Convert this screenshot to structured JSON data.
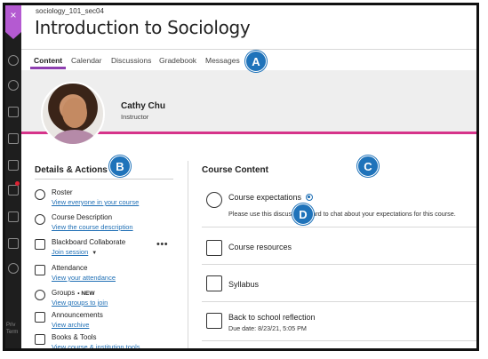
{
  "header": {
    "course_code": "sociology_101_sec04",
    "course_title": "Introduction to Sociology",
    "close_glyph": "×"
  },
  "tabs": [
    {
      "label": "Content",
      "active": true
    },
    {
      "label": "Calendar",
      "active": false
    },
    {
      "label": "Discussions",
      "active": false
    },
    {
      "label": "Gradebook",
      "active": false
    },
    {
      "label": "Messages",
      "active": false
    }
  ],
  "instructor": {
    "name": "Cathy Chu",
    "role": "Instructor"
  },
  "details": {
    "title": "Details & Actions",
    "items": [
      {
        "label": "Roster",
        "link": "View everyone in your course",
        "icon": "roster-icon"
      },
      {
        "label": "Course Description",
        "link": "View the course description",
        "icon": "info-icon"
      },
      {
        "label": "Blackboard Collaborate",
        "link": "Join session",
        "icon": "collaborate-icon"
      },
      {
        "label": "Attendance",
        "link": "View your attendance",
        "icon": "attendance-icon"
      },
      {
        "label": "Groups",
        "badge": "NEW",
        "link": "View groups to join",
        "icon": "groups-icon"
      },
      {
        "label": "Announcements",
        "link": "View archive",
        "icon": "megaphone-icon"
      },
      {
        "label": "Books & Tools",
        "link": "View course & institution tools",
        "icon": "wrench-icon"
      }
    ],
    "more": "•••"
  },
  "content": {
    "title": "Course Content",
    "items": [
      {
        "name": "Course expectations",
        "description": "Please use this discussion board to chat about your expectations for this course.",
        "icon": "discussion-icon"
      },
      {
        "name": "Course resources",
        "icon": "folder-icon"
      },
      {
        "name": "Syllabus",
        "icon": "document-icon"
      },
      {
        "name": "Back to school reflection",
        "due": "Due date: 8/23/21, 5:05 PM",
        "icon": "assignment-icon"
      }
    ]
  },
  "rail": {
    "privacy_text": "Priv\nTerm"
  },
  "callouts": [
    "A",
    "B",
    "C",
    "D"
  ],
  "colors": {
    "accent_purple": "#8e3fb0",
    "banner_stripe": "#d6338a",
    "link_blue": "#1f6fb5",
    "callout_blue": "#1f73ba"
  }
}
